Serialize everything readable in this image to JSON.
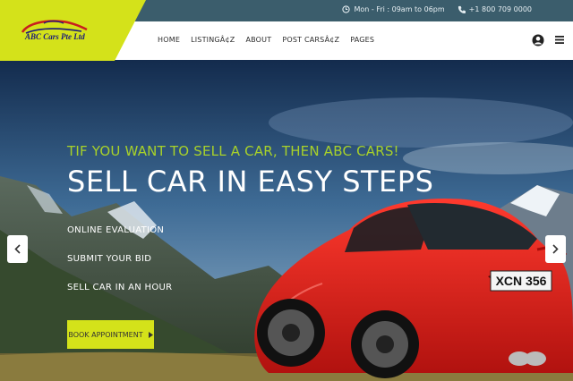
{
  "topbar": {
    "hours": "Mon - Fri : 09am to 06pm",
    "phone": "+1 800 709 0000",
    "clock_icon": "clock-icon",
    "phone_icon": "phone-icon"
  },
  "brand": {
    "logo_text": "ABC Cars Pte Ltd"
  },
  "nav": {
    "items": [
      "HOME",
      "LISTINGÂ¢Z",
      "ABOUT",
      "POST CARSÂ¢Z",
      "PAGES"
    ]
  },
  "hero": {
    "tagline": "TIF YOU WANT TO SELL A CAR, THEN ABC CARS!",
    "headline": "SELL CAR IN EASY STEPS",
    "steps": [
      "ONLINE EVALUATION",
      "SUBMIT YOUR BID",
      "SELL CAR IN AN HOUR"
    ],
    "cta_label": "BOOK APPOINTMENT",
    "plate": "XCN 356"
  },
  "colors": {
    "accent": "#d4e21a",
    "topbar": "#3b5d6c",
    "tagline": "#a8d12a"
  }
}
